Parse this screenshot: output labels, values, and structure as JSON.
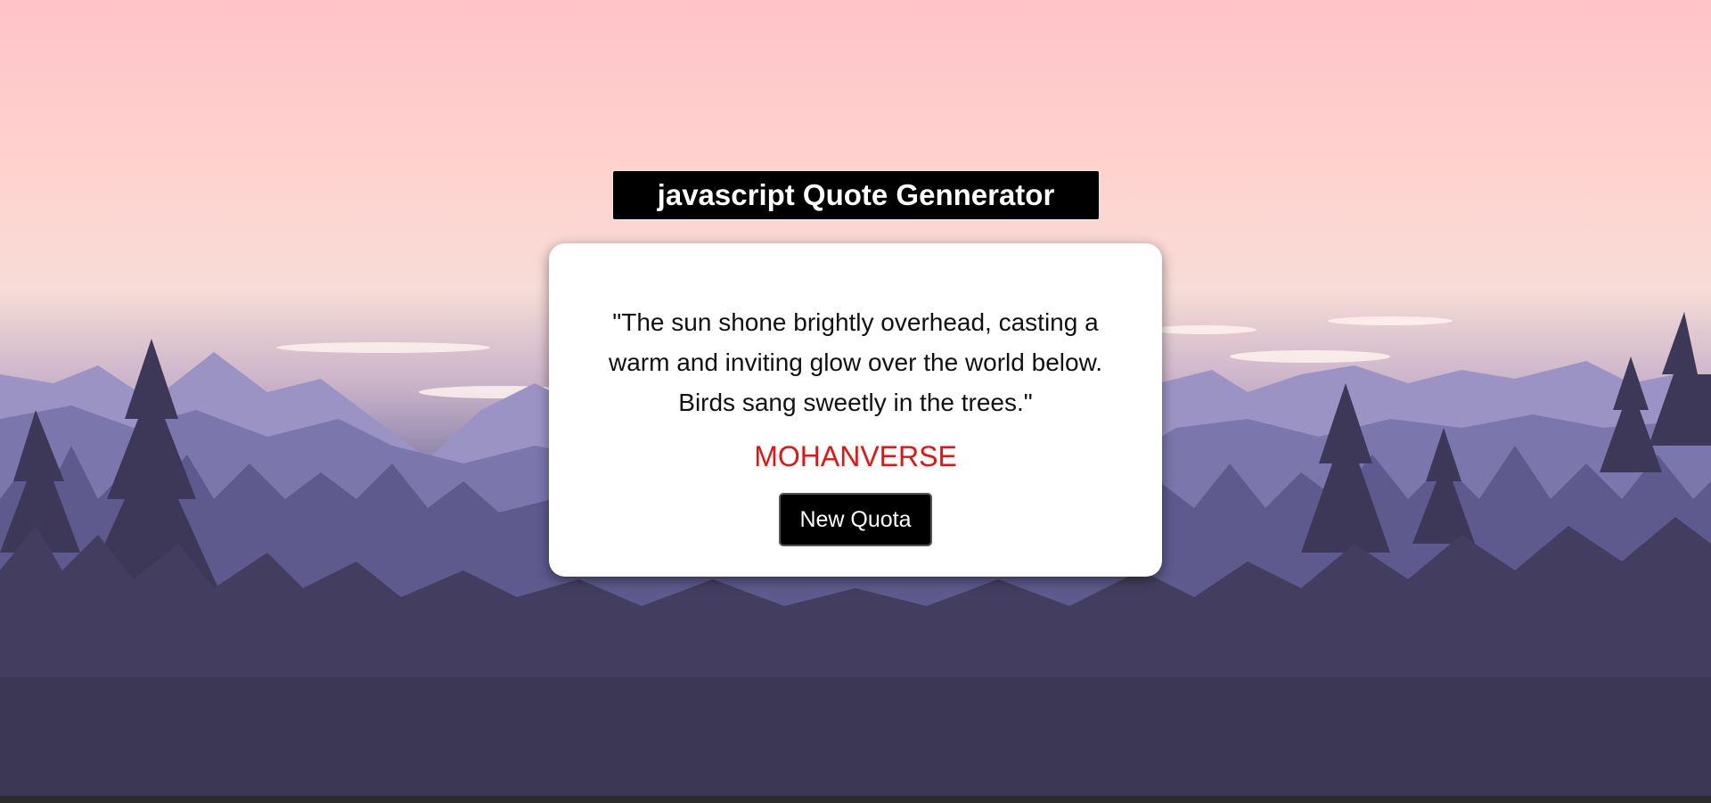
{
  "header": {
    "title": "javascript Quote Gennerator"
  },
  "quote_card": {
    "quote_text": "\"The sun shone brightly overhead, casting a warm and inviting glow over the world below. Birds sang sweetly in the trees.\"",
    "author": "MOHANVERSE",
    "new_button_label": "New Quota"
  },
  "colors": {
    "author": "#e31414",
    "title_bg": "#000000",
    "button_bg": "#000000",
    "card_bg": "#ffffff"
  },
  "background": {
    "description_icon": "mountain-forest-landscape"
  }
}
